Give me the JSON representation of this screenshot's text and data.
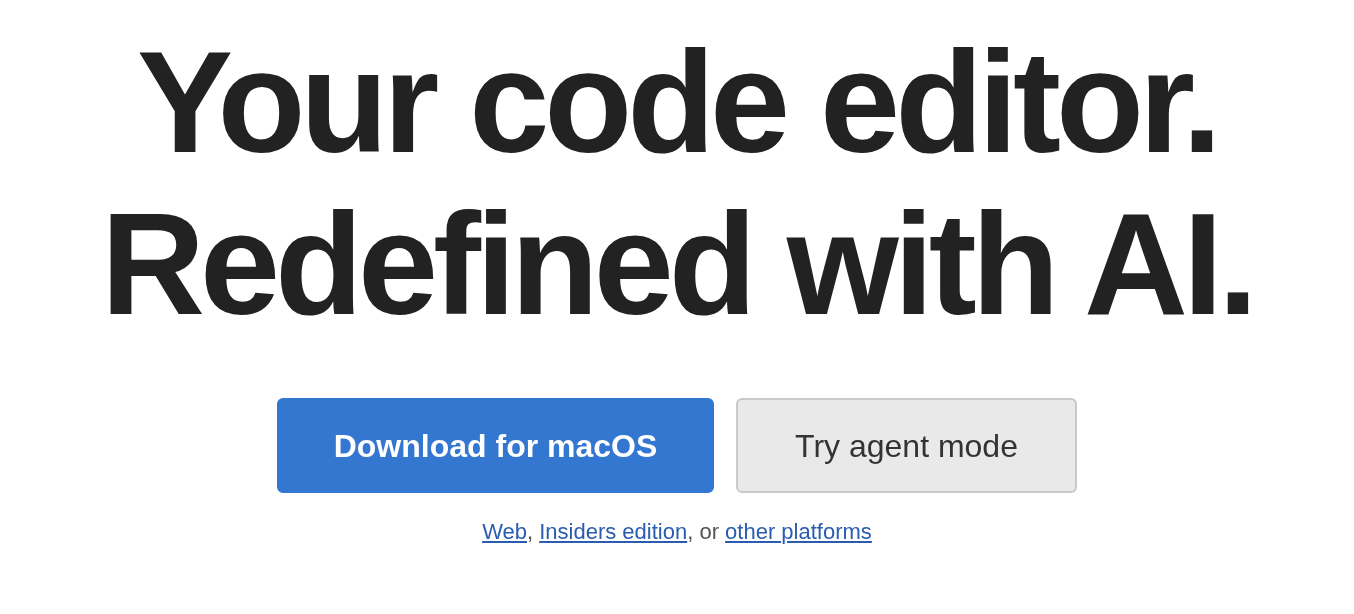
{
  "headline": {
    "lines": [
      "Your code editor.",
      "Redefined with AI."
    ]
  },
  "buttons": [
    {
      "label": "Download for macOS",
      "kind": "primary"
    },
    {
      "label": "Try agent mode",
      "kind": "secondary"
    }
  ],
  "alternatives": [
    {
      "kind": "link",
      "text": "Web"
    },
    {
      "kind": "text",
      "text": ", "
    },
    {
      "kind": "link",
      "text": "Insiders edition"
    },
    {
      "kind": "text",
      "text": ", or "
    },
    {
      "kind": "link",
      "text": "other platforms"
    }
  ]
}
